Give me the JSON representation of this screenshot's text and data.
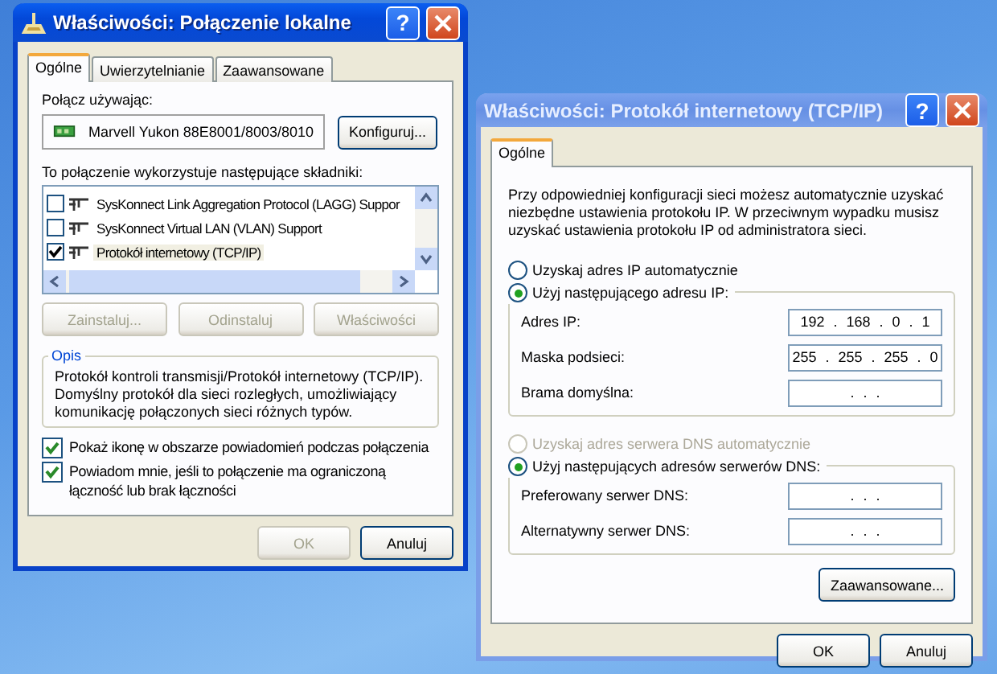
{
  "connection_window": {
    "title": "Właściwości: Połączenie lokalne",
    "help_button": "?",
    "tabs": [
      {
        "label": "Ogólne",
        "selected": true
      },
      {
        "label": "Uwierzytelnianie",
        "selected": false
      },
      {
        "label": "Zaawansowane",
        "selected": false
      }
    ],
    "connect_using": {
      "label": "Połącz używając:",
      "adapter": "Marvell Yukon 88E8001/8003/8010",
      "configure_button": "Konfiguruj..."
    },
    "components": {
      "label": "To połączenie wykorzystuje następujące składniki:",
      "items": [
        {
          "name": "SysKonnect Link Aggregation Protocol (LAGG) Suppor",
          "checked": false,
          "selected": false
        },
        {
          "name": "SysKonnect Virtual LAN (VLAN) Support",
          "checked": false,
          "selected": false
        },
        {
          "name": "Protokół internetowy (TCP/IP)",
          "checked": true,
          "selected": true
        }
      ]
    },
    "component_buttons": [
      {
        "label": "Zainstaluj...",
        "disabled": true
      },
      {
        "label": "Odinstaluj",
        "disabled": true
      },
      {
        "label": "Właściwości",
        "disabled": true
      }
    ],
    "description": {
      "title": "Opis",
      "text": "Protokół kontroli transmisji/Protokół internetowy (TCP/IP). Domyślny protokół dla sieci rozległych, umożliwiający komunikację połączonych sieci różnych typów."
    },
    "options": [
      {
        "label": "Pokaż ikonę w obszarze powiadomień podczas połączenia",
        "checked": true
      },
      {
        "label": "Powiadom mnie, jeśli to połączenie ma ograniczoną łączność lub brak łączności",
        "checked": true
      }
    ],
    "footer_buttons": [
      {
        "label": "OK",
        "disabled": true
      },
      {
        "label": "Anuluj",
        "disabled": false
      }
    ]
  },
  "tcpip_window": {
    "title": "Właściwości: Protokół internetowy (TCP/IP)",
    "help_button": "?",
    "tabs": [
      {
        "label": "Ogólne",
        "selected": true
      }
    ],
    "intro": "Przy odpowiedniej konfiguracji sieci możesz automatycznie uzyskać niezbędne ustawienia protokołu IP. W przeciwnym wypadku musisz uzyskać ustawienia protokołu IP od administratora sieci.",
    "ip_modes": [
      {
        "label": "Uzyskaj adres IP automatycznie",
        "selected": false,
        "disabled": false
      },
      {
        "label": "Użyj następującego adresu IP:",
        "selected": true,
        "disabled": false
      }
    ],
    "ip_fields": [
      {
        "label": "Adres IP:",
        "value": "192 . 168 . 0 . 1"
      },
      {
        "label": "Maska podsieci:",
        "value": "255 . 255 . 255 . 0"
      },
      {
        "label": "Brama domyślna:",
        "value": ". . ."
      }
    ],
    "dns_modes": [
      {
        "label": "Uzyskaj adres serwera DNS automatycznie",
        "selected": false,
        "disabled": true
      },
      {
        "label": "Użyj następujących adresów serwerów DNS:",
        "selected": true,
        "disabled": false
      }
    ],
    "dns_fields": [
      {
        "label": "Preferowany serwer DNS:",
        "value": ". . ."
      },
      {
        "label": "Alternatywny serwer DNS:",
        "value": ". . ."
      }
    ],
    "advanced_button": "Zaawansowane...",
    "footer_buttons": [
      {
        "label": "OK",
        "disabled": false
      },
      {
        "label": "Anuluj",
        "disabled": false
      }
    ]
  }
}
